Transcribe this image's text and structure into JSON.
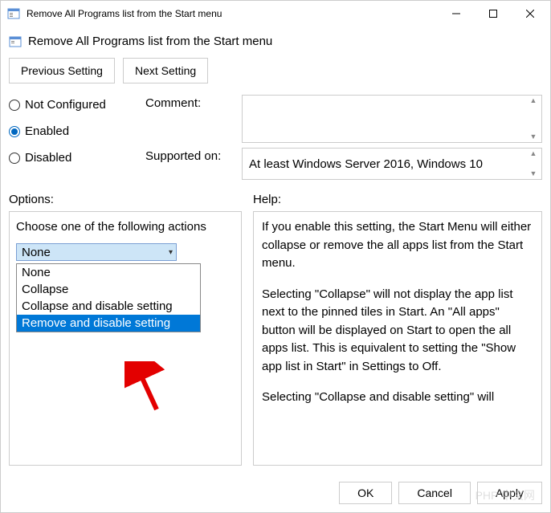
{
  "window": {
    "title": "Remove All Programs list from the Start menu"
  },
  "header": {
    "title": "Remove All Programs list from the Start menu"
  },
  "nav": {
    "prev": "Previous Setting",
    "next": "Next Setting"
  },
  "state": {
    "not_configured": "Not Configured",
    "enabled": "Enabled",
    "disabled": "Disabled",
    "selected": "enabled"
  },
  "fields": {
    "comment_label": "Comment:",
    "comment_value": "",
    "supported_label": "Supported on:",
    "supported_value": "At least Windows Server 2016, Windows 10"
  },
  "panels": {
    "options_label": "Options:",
    "help_label": "Help:"
  },
  "options": {
    "prompt": "Choose one of the following actions",
    "selected": "None",
    "items": [
      "None",
      "Collapse",
      "Collapse and disable setting",
      "Remove and disable setting"
    ],
    "highlighted_index": 3
  },
  "help": {
    "p1": "If you enable this setting, the Start Menu will either collapse or remove the all apps list from the Start menu.",
    "p2": "Selecting \"Collapse\" will not display the app list next to the pinned tiles in Start. An \"All apps\" button will be displayed on Start to open the all apps list. This is equivalent to setting the \"Show app list in Start\" in Settings to Off.",
    "p3": "Selecting \"Collapse and disable setting\" will"
  },
  "footer": {
    "ok": "OK",
    "cancel": "Cancel",
    "apply": "Apply"
  },
  "watermark": "PHP 中文网"
}
